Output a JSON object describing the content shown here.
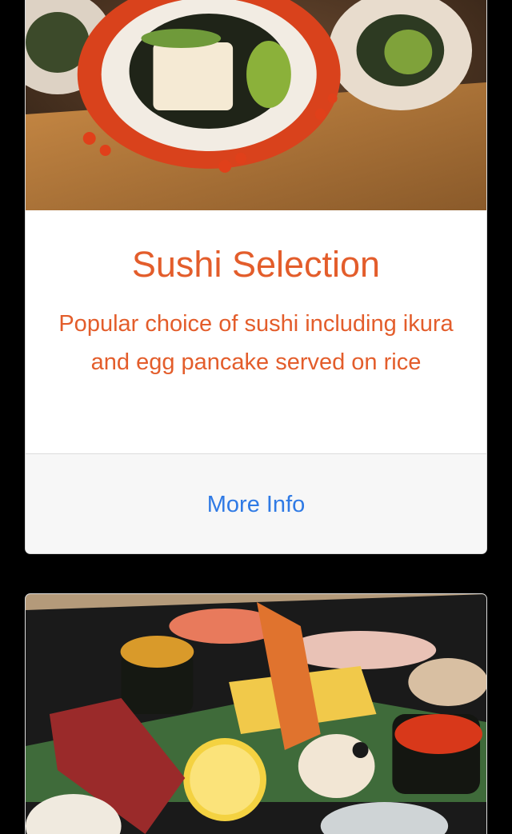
{
  "cards": [
    {
      "image_icon": "sushi-roll-photo",
      "title": "Sushi Selection",
      "description": "Popular choice of sushi including ikura and egg pancake served on rice",
      "link_label": "More Info"
    },
    {
      "image_icon": "nigiri-platter-photo"
    }
  ],
  "colors": {
    "accent": "#e35d2b",
    "link": "#2f7ae5",
    "footer_bg": "#f7f7f7",
    "page_bg": "#000000"
  }
}
